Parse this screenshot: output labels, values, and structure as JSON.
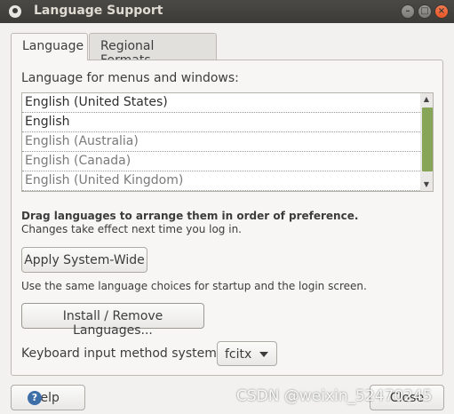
{
  "window": {
    "title": "Language Support",
    "buttons": {
      "minimize": "–",
      "maximize": "□",
      "close": "×"
    }
  },
  "tabs": [
    {
      "label": "Language",
      "active": true
    },
    {
      "label": "Regional Formats",
      "active": false
    }
  ],
  "language_tab": {
    "heading": "Language for menus and windows:",
    "languages": [
      {
        "label": "English (United States)",
        "state": "active"
      },
      {
        "label": "English",
        "state": "active"
      },
      {
        "label": "English (Australia)",
        "state": "inactive"
      },
      {
        "label": "English (Canada)",
        "state": "inactive"
      },
      {
        "label": "English (United Kingdom)",
        "state": "inactive"
      }
    ],
    "scroll": {
      "up": "▲",
      "down": "▼"
    },
    "drag_hint": "Drag languages to arrange them in order of preference.",
    "change_hint": "Changes take effect next time you log in.",
    "apply_button": "Apply System-Wide",
    "apply_note": "Use the same language choices for startup and the login screen.",
    "install_button": "Install / Remove Languages...",
    "keyboard_label": "Keyboard input method system:",
    "keyboard_value": "fcitx"
  },
  "footer": {
    "help_button": "Help",
    "help_icon": "?",
    "close_button": "Close"
  },
  "watermark": "CSDN @weixin_52470245",
  "colors": {
    "titlebar": "#3c3b37",
    "scroll_thumb": "#87a556",
    "close_button": "#e65625"
  }
}
